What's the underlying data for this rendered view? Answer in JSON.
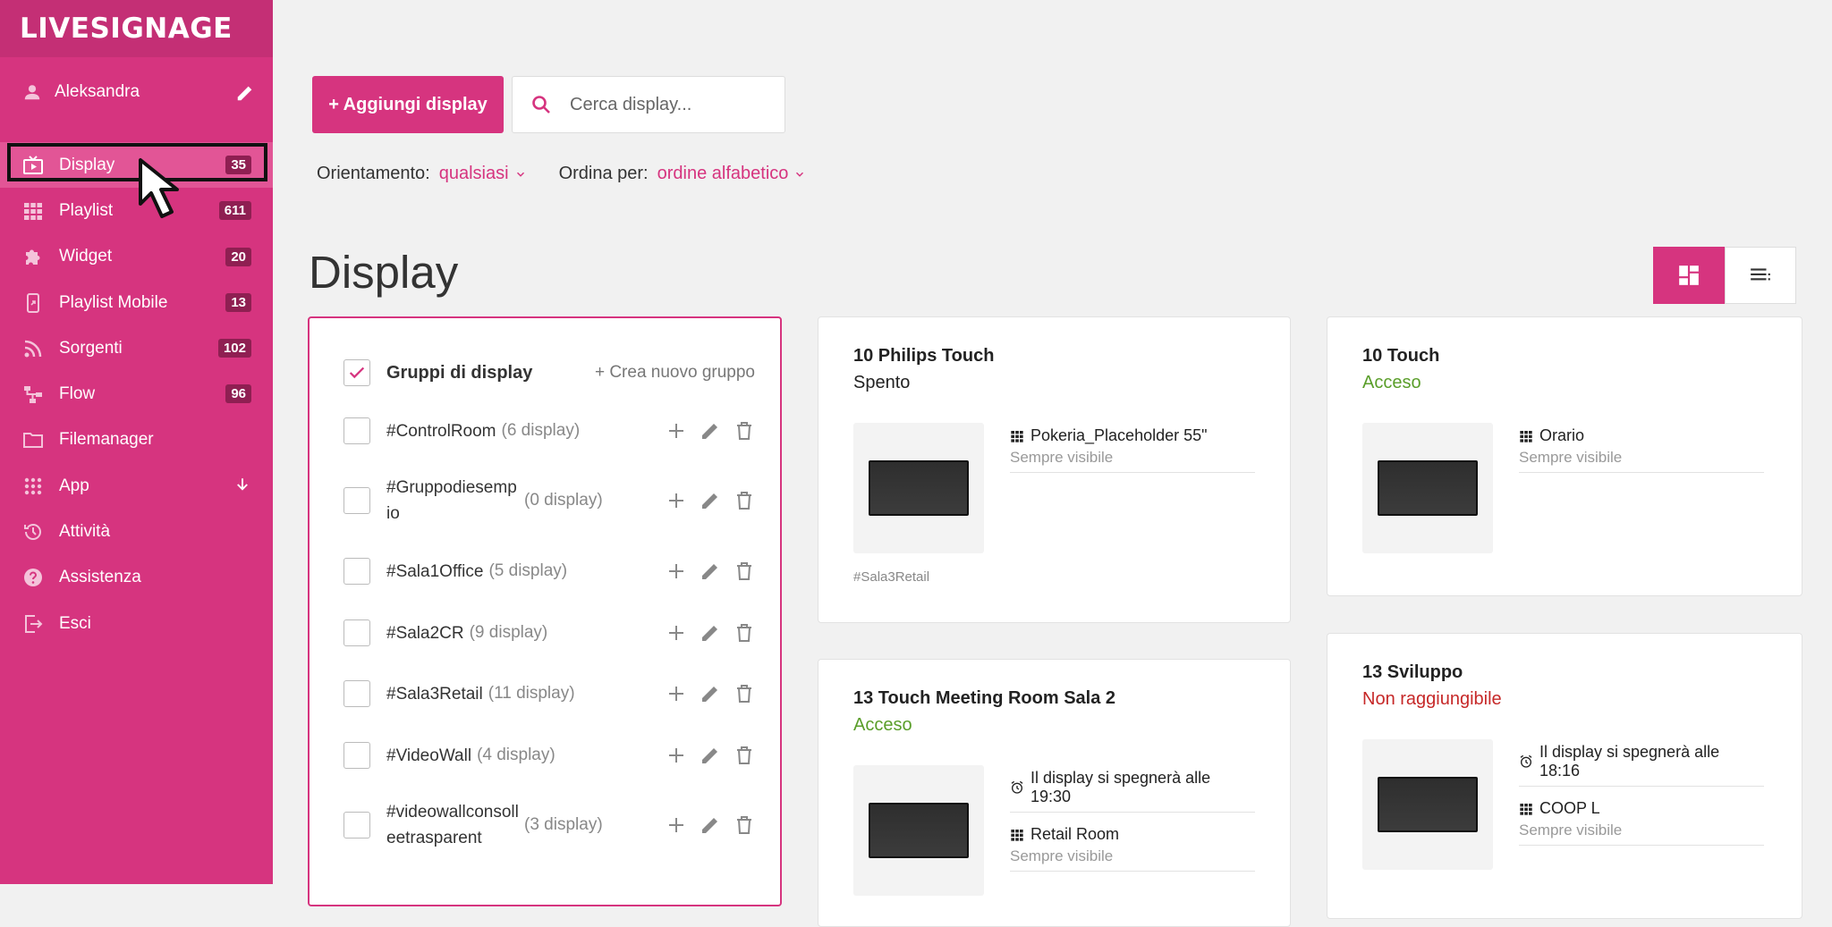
{
  "brand": {
    "logo": "LIVESIGNAGE",
    "accent": "#d6347f",
    "sidebar_bg": "#d6347f"
  },
  "user": {
    "name": "Aleksandra"
  },
  "nav": [
    {
      "label": "Display",
      "badge": "35",
      "icon": "tv-play-icon",
      "active": true
    },
    {
      "label": "Playlist",
      "badge": "611",
      "icon": "grid-icon"
    },
    {
      "label": "Widget",
      "badge": "20",
      "icon": "puzzle-icon"
    },
    {
      "label": "Playlist Mobile",
      "badge": "13",
      "icon": "mobile-icon"
    },
    {
      "label": "Sorgenti",
      "badge": "102",
      "icon": "rss-icon"
    },
    {
      "label": "Flow",
      "badge": "96",
      "icon": "flow-icon"
    },
    {
      "label": "Filemanager",
      "icon": "folder-icon"
    },
    {
      "label": "App",
      "icon": "apps-icon",
      "expand": true
    },
    {
      "label": "Attività",
      "icon": "history-icon"
    },
    {
      "label": "Assistenza",
      "icon": "help-icon"
    },
    {
      "label": "Esci",
      "icon": "logout-icon"
    }
  ],
  "toolbar": {
    "add_label": "+ Aggiungi display",
    "search_placeholder": "Cerca display..."
  },
  "filters": {
    "orientation_label": "Orientamento:",
    "orientation_value": "qualsiasi",
    "sort_label": "Ordina per:",
    "sort_value": "ordine alfabetico"
  },
  "page_title": "Display",
  "groups": {
    "title": "Gruppi di display",
    "create": "+ Crea nuovo gruppo",
    "items": [
      {
        "name": "#ControlRoom",
        "count": "(6 display)"
      },
      {
        "name": "#Gruppodiesempio",
        "count": "(0 display)"
      },
      {
        "name": "#Sala1Office",
        "count": "(5 display)"
      },
      {
        "name": "#Sala2CR",
        "count": "(9 display)"
      },
      {
        "name": "#Sala3Retail",
        "count": "(11 display)"
      },
      {
        "name": "#VideoWall",
        "count": "(4 display)"
      },
      {
        "name": "#videowallconsolleetrasparent",
        "count": "(3 display)"
      }
    ]
  },
  "cards": [
    {
      "name": "10 Philips Touch",
      "status": "Spento",
      "playlist": "Pokeria_Placeholder 55\"",
      "visibility": "Sempre visibile",
      "tag": "#Sala3Retail"
    },
    {
      "name": "10 Touch",
      "status": "Acceso",
      "playlist": "Orario",
      "visibility": "Sempre visibile"
    },
    {
      "name": "13 Touch Meeting Room Sala 2",
      "status": "Acceso",
      "schedule": "Il display si spegnerà alle 19:30",
      "playlist": "Retail Room",
      "visibility": "Sempre visibile"
    },
    {
      "name": "13 Sviluppo",
      "status": "Non raggiungibile",
      "schedule": "Il display si spegnerà alle 18:16",
      "playlist": "COOP L",
      "visibility": "Sempre visibile"
    }
  ]
}
